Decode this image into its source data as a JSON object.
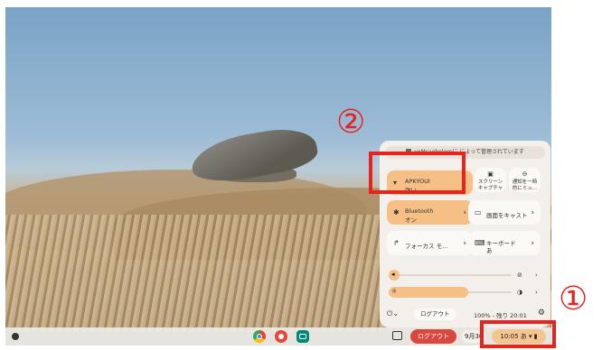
{
  "managed_text": "yoMcaehnlerpに によって管理されています",
  "tiles": {
    "network": {
      "title": "APKYOUI",
      "sub": "強い",
      "icon": "wifi-icon"
    },
    "screen_capture": {
      "line1": "スクリーン",
      "line2": "キャプチャ",
      "icon": "screen-capture-icon"
    },
    "notifications": {
      "line1": "通知を一時",
      "line2": "的にミュ...",
      "icon": "do-not-disturb-icon"
    },
    "bluetooth": {
      "title": "Bluetooth",
      "sub": "オン",
      "icon": "bluetooth-icon"
    },
    "cast": {
      "title": "画面をキャスト",
      "icon": "cast-icon"
    },
    "focus": {
      "title": "フォーカス モ...",
      "icon": "focus-icon"
    },
    "keyboard": {
      "title": "キーボード",
      "sub": "あ",
      "icon": "keyboard-icon"
    }
  },
  "sliders": {
    "volume_level": 0.06,
    "brightness_level": 0.65
  },
  "bottom": {
    "logout_label": "ログアウト",
    "battery_text": "100% - 残り 20:01",
    "power_chevron": "⌄"
  },
  "shelf": {
    "logout_label": "ログアウト",
    "date_text": "9月30",
    "time_text": "10:05",
    "ime_text": "あ"
  },
  "annotations": {
    "mark1": "①",
    "mark2": "②",
    "highlight_color": "#e8221c"
  },
  "colors": {
    "accent": "#f6bf85",
    "panel": "#f3efea"
  }
}
